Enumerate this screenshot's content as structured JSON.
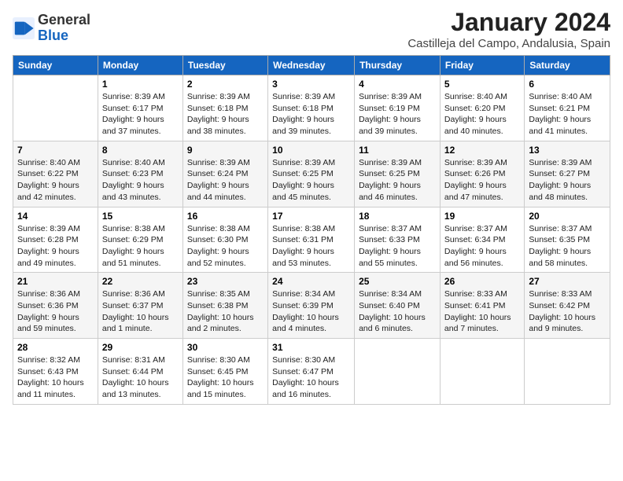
{
  "logo": {
    "line1": "General",
    "line2": "Blue"
  },
  "title": "January 2024",
  "subtitle": "Castilleja del Campo, Andalusia, Spain",
  "weekdays": [
    "Sunday",
    "Monday",
    "Tuesday",
    "Wednesday",
    "Thursday",
    "Friday",
    "Saturday"
  ],
  "weeks": [
    [
      {
        "day": "",
        "sunrise": "",
        "sunset": "",
        "daylight": ""
      },
      {
        "day": "1",
        "sunrise": "Sunrise: 8:39 AM",
        "sunset": "Sunset: 6:17 PM",
        "daylight": "Daylight: 9 hours and 37 minutes."
      },
      {
        "day": "2",
        "sunrise": "Sunrise: 8:39 AM",
        "sunset": "Sunset: 6:18 PM",
        "daylight": "Daylight: 9 hours and 38 minutes."
      },
      {
        "day": "3",
        "sunrise": "Sunrise: 8:39 AM",
        "sunset": "Sunset: 6:18 PM",
        "daylight": "Daylight: 9 hours and 39 minutes."
      },
      {
        "day": "4",
        "sunrise": "Sunrise: 8:39 AM",
        "sunset": "Sunset: 6:19 PM",
        "daylight": "Daylight: 9 hours and 39 minutes."
      },
      {
        "day": "5",
        "sunrise": "Sunrise: 8:40 AM",
        "sunset": "Sunset: 6:20 PM",
        "daylight": "Daylight: 9 hours and 40 minutes."
      },
      {
        "day": "6",
        "sunrise": "Sunrise: 8:40 AM",
        "sunset": "Sunset: 6:21 PM",
        "daylight": "Daylight: 9 hours and 41 minutes."
      }
    ],
    [
      {
        "day": "7",
        "sunrise": "Sunrise: 8:40 AM",
        "sunset": "Sunset: 6:22 PM",
        "daylight": "Daylight: 9 hours and 42 minutes."
      },
      {
        "day": "8",
        "sunrise": "Sunrise: 8:40 AM",
        "sunset": "Sunset: 6:23 PM",
        "daylight": "Daylight: 9 hours and 43 minutes."
      },
      {
        "day": "9",
        "sunrise": "Sunrise: 8:39 AM",
        "sunset": "Sunset: 6:24 PM",
        "daylight": "Daylight: 9 hours and 44 minutes."
      },
      {
        "day": "10",
        "sunrise": "Sunrise: 8:39 AM",
        "sunset": "Sunset: 6:25 PM",
        "daylight": "Daylight: 9 hours and 45 minutes."
      },
      {
        "day": "11",
        "sunrise": "Sunrise: 8:39 AM",
        "sunset": "Sunset: 6:25 PM",
        "daylight": "Daylight: 9 hours and 46 minutes."
      },
      {
        "day": "12",
        "sunrise": "Sunrise: 8:39 AM",
        "sunset": "Sunset: 6:26 PM",
        "daylight": "Daylight: 9 hours and 47 minutes."
      },
      {
        "day": "13",
        "sunrise": "Sunrise: 8:39 AM",
        "sunset": "Sunset: 6:27 PM",
        "daylight": "Daylight: 9 hours and 48 minutes."
      }
    ],
    [
      {
        "day": "14",
        "sunrise": "Sunrise: 8:39 AM",
        "sunset": "Sunset: 6:28 PM",
        "daylight": "Daylight: 9 hours and 49 minutes."
      },
      {
        "day": "15",
        "sunrise": "Sunrise: 8:38 AM",
        "sunset": "Sunset: 6:29 PM",
        "daylight": "Daylight: 9 hours and 51 minutes."
      },
      {
        "day": "16",
        "sunrise": "Sunrise: 8:38 AM",
        "sunset": "Sunset: 6:30 PM",
        "daylight": "Daylight: 9 hours and 52 minutes."
      },
      {
        "day": "17",
        "sunrise": "Sunrise: 8:38 AM",
        "sunset": "Sunset: 6:31 PM",
        "daylight": "Daylight: 9 hours and 53 minutes."
      },
      {
        "day": "18",
        "sunrise": "Sunrise: 8:37 AM",
        "sunset": "Sunset: 6:33 PM",
        "daylight": "Daylight: 9 hours and 55 minutes."
      },
      {
        "day": "19",
        "sunrise": "Sunrise: 8:37 AM",
        "sunset": "Sunset: 6:34 PM",
        "daylight": "Daylight: 9 hours and 56 minutes."
      },
      {
        "day": "20",
        "sunrise": "Sunrise: 8:37 AM",
        "sunset": "Sunset: 6:35 PM",
        "daylight": "Daylight: 9 hours and 58 minutes."
      }
    ],
    [
      {
        "day": "21",
        "sunrise": "Sunrise: 8:36 AM",
        "sunset": "Sunset: 6:36 PM",
        "daylight": "Daylight: 9 hours and 59 minutes."
      },
      {
        "day": "22",
        "sunrise": "Sunrise: 8:36 AM",
        "sunset": "Sunset: 6:37 PM",
        "daylight": "Daylight: 10 hours and 1 minute."
      },
      {
        "day": "23",
        "sunrise": "Sunrise: 8:35 AM",
        "sunset": "Sunset: 6:38 PM",
        "daylight": "Daylight: 10 hours and 2 minutes."
      },
      {
        "day": "24",
        "sunrise": "Sunrise: 8:34 AM",
        "sunset": "Sunset: 6:39 PM",
        "daylight": "Daylight: 10 hours and 4 minutes."
      },
      {
        "day": "25",
        "sunrise": "Sunrise: 8:34 AM",
        "sunset": "Sunset: 6:40 PM",
        "daylight": "Daylight: 10 hours and 6 minutes."
      },
      {
        "day": "26",
        "sunrise": "Sunrise: 8:33 AM",
        "sunset": "Sunset: 6:41 PM",
        "daylight": "Daylight: 10 hours and 7 minutes."
      },
      {
        "day": "27",
        "sunrise": "Sunrise: 8:33 AM",
        "sunset": "Sunset: 6:42 PM",
        "daylight": "Daylight: 10 hours and 9 minutes."
      }
    ],
    [
      {
        "day": "28",
        "sunrise": "Sunrise: 8:32 AM",
        "sunset": "Sunset: 6:43 PM",
        "daylight": "Daylight: 10 hours and 11 minutes."
      },
      {
        "day": "29",
        "sunrise": "Sunrise: 8:31 AM",
        "sunset": "Sunset: 6:44 PM",
        "daylight": "Daylight: 10 hours and 13 minutes."
      },
      {
        "day": "30",
        "sunrise": "Sunrise: 8:30 AM",
        "sunset": "Sunset: 6:45 PM",
        "daylight": "Daylight: 10 hours and 15 minutes."
      },
      {
        "day": "31",
        "sunrise": "Sunrise: 8:30 AM",
        "sunset": "Sunset: 6:47 PM",
        "daylight": "Daylight: 10 hours and 16 minutes."
      },
      {
        "day": "",
        "sunrise": "",
        "sunset": "",
        "daylight": ""
      },
      {
        "day": "",
        "sunrise": "",
        "sunset": "",
        "daylight": ""
      },
      {
        "day": "",
        "sunrise": "",
        "sunset": "",
        "daylight": ""
      }
    ]
  ]
}
